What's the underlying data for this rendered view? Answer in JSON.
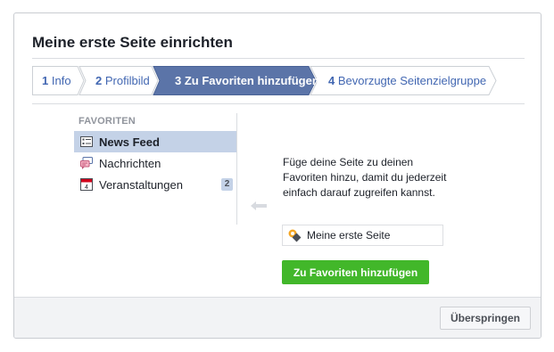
{
  "dialog": {
    "title": "Meine erste Seite einrichten"
  },
  "steps": [
    {
      "number": "1",
      "label": "Info",
      "active": false
    },
    {
      "number": "2",
      "label": "Profilbild",
      "active": false
    },
    {
      "number": "3",
      "label": "Zu Favoriten hinzufügen",
      "active": true
    },
    {
      "number": "4",
      "label": "Bevorzugte Seitenzielgruppe",
      "active": false
    }
  ],
  "favorites": {
    "header": "FAVORITEN",
    "items": [
      {
        "label": "News Feed",
        "icon": "news-feed-icon",
        "selected": true,
        "badge": ""
      },
      {
        "label": "Nachrichten",
        "icon": "messages-icon",
        "selected": false,
        "badge": ""
      },
      {
        "label": "Veranstaltungen",
        "icon": "calendar-icon",
        "selected": false,
        "badge": "2",
        "icon_text": "4"
      }
    ]
  },
  "main": {
    "description": "Füge deine Seite zu deinen Favoriten hinzu, damit du jederzeit einfach darauf zugreifen kannst.",
    "page_name": "Meine erste Seite",
    "add_button_label": "Zu Favoriten hinzufügen"
  },
  "footer": {
    "skip_label": "Überspringen"
  },
  "colors": {
    "active_step": "#5b74a8",
    "link": "#4267b2",
    "selected_row": "#c4d2e7",
    "primary_button": "#42b72a"
  }
}
